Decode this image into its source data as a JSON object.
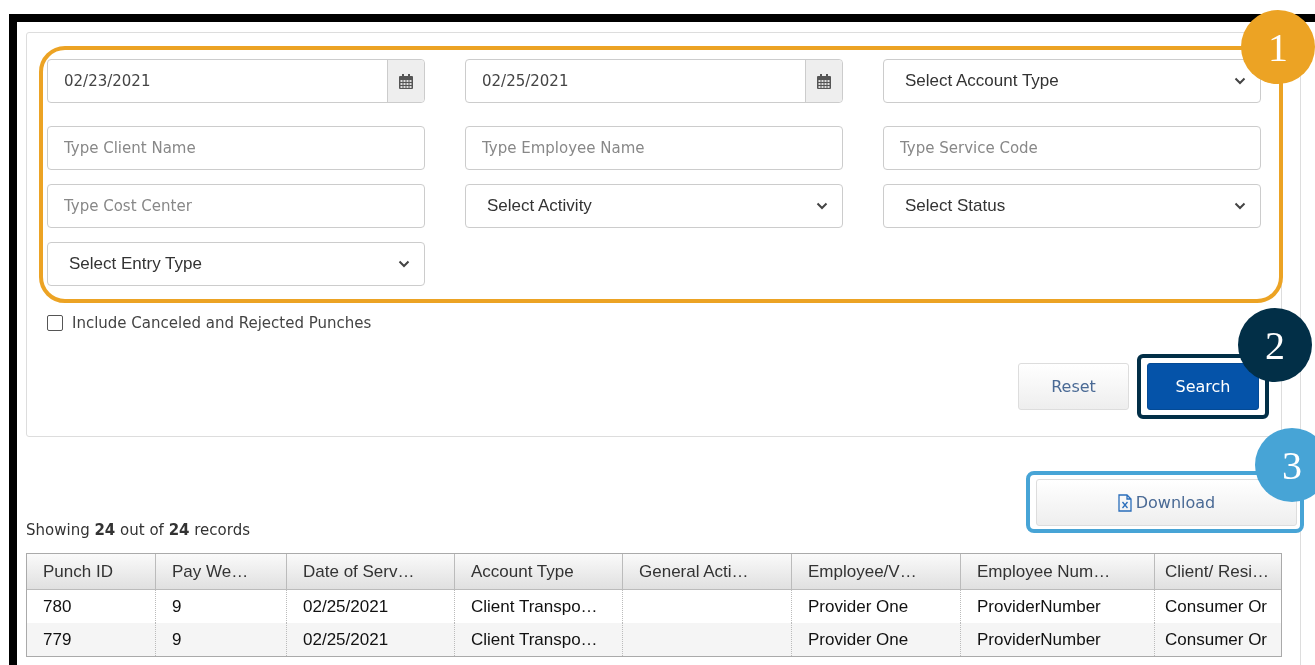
{
  "filters": [
    {
      "kind": "date",
      "value": "02/23/2021"
    },
    {
      "kind": "date",
      "value": "02/25/2021"
    },
    {
      "kind": "select",
      "value": "Select Account Type"
    },
    {
      "kind": "text",
      "placeholder": "Type Client Name"
    },
    {
      "kind": "text",
      "placeholder": "Type Employee Name"
    },
    {
      "kind": "text",
      "placeholder": "Type Service Code"
    },
    {
      "kind": "text",
      "placeholder": "Type Cost Center"
    },
    {
      "kind": "select",
      "value": "Select Activity"
    },
    {
      "kind": "select",
      "value": "Select Status"
    },
    {
      "kind": "select",
      "value": "Select Entry Type"
    }
  ],
  "include_canceled": {
    "label": "Include Canceled and Rejected Punches",
    "checked": false
  },
  "buttons": [
    {
      "label": "Reset",
      "kind": "secondary"
    },
    {
      "label": "Search",
      "kind": "primary"
    }
  ],
  "download": {
    "label": "Download"
  },
  "summary": "Showing **24** out of **24** records",
  "table": {
    "columns": [
      "Punch ID",
      "Pay We…",
      "Date of Serv…",
      "Account Type",
      "General Acti…",
      "Employee/V…",
      "Employee Num…",
      "Client/ Resi…"
    ],
    "rows": [
      [
        "780",
        "9",
        "02/25/2021",
        "Client Transpo…",
        null,
        "Provider One",
        "ProviderNumber",
        "Consumer Or"
      ],
      [
        "779",
        "9",
        "02/25/2021",
        "Client Transpo…",
        null,
        "Provider One",
        "ProviderNumber",
        "Consumer Or"
      ]
    ]
  },
  "callouts": [
    {
      "label": "1",
      "color": "#eca324"
    },
    {
      "label": "2",
      "color": "#022f47"
    },
    {
      "label": "3",
      "color": "#47a4d6"
    }
  ]
}
